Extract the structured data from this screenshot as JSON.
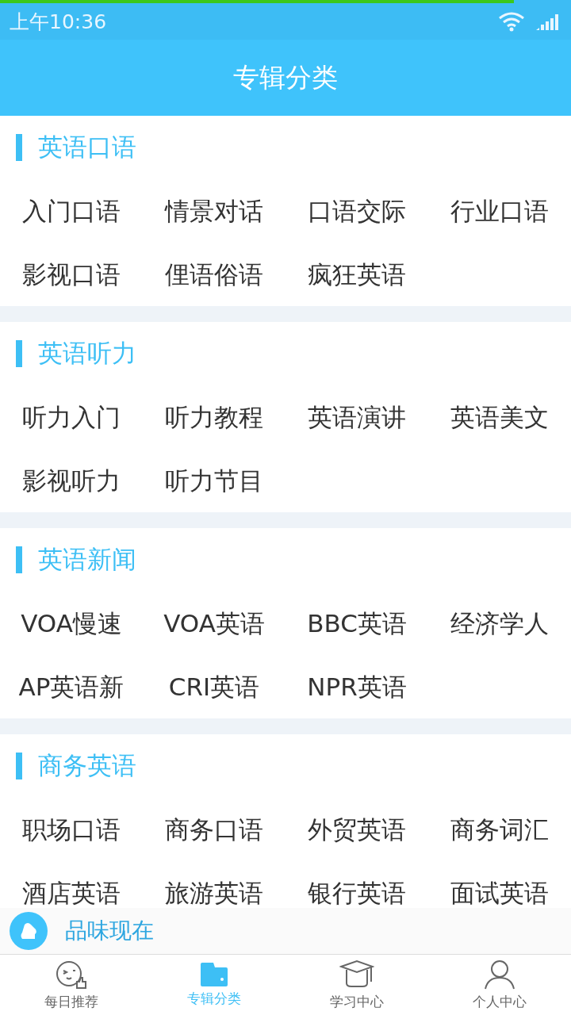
{
  "loading_bar": {
    "level": 0.9
  },
  "status_bar": {
    "time": "上午10:36"
  },
  "header": {
    "title": "专辑分类"
  },
  "sections": [
    {
      "title": "英语口语",
      "items": [
        "入门口语",
        "情景对话",
        "口语交际",
        "行业口语",
        "影视口语",
        "俚语俗语",
        "疯狂英语"
      ]
    },
    {
      "title": "英语听力",
      "items": [
        "听力入门",
        "听力教程",
        "英语演讲",
        "英语美文",
        "影视听力",
        "听力节目"
      ]
    },
    {
      "title": "英语新闻",
      "items": [
        "VOA慢速",
        "VOA英语",
        "BBC英语",
        "经济学人",
        "AP英语新",
        "CRI英语",
        "NPR英语"
      ]
    },
    {
      "title": "商务英语",
      "items": [
        "职场口语",
        "商务口语",
        "外贸英语",
        "商务词汇",
        "酒店英语",
        "旅游英语",
        "银行英语",
        "面试英语"
      ]
    }
  ],
  "mini_player": {
    "title": "品味现在"
  },
  "tabs": [
    {
      "label": "每日推荐",
      "kind": "smile",
      "selected": false
    },
    {
      "label": "专辑分类",
      "kind": "folder",
      "selected": true
    },
    {
      "label": "学习中心",
      "kind": "cap",
      "selected": false
    },
    {
      "label": "个人中心",
      "kind": "person",
      "selected": false
    }
  ]
}
